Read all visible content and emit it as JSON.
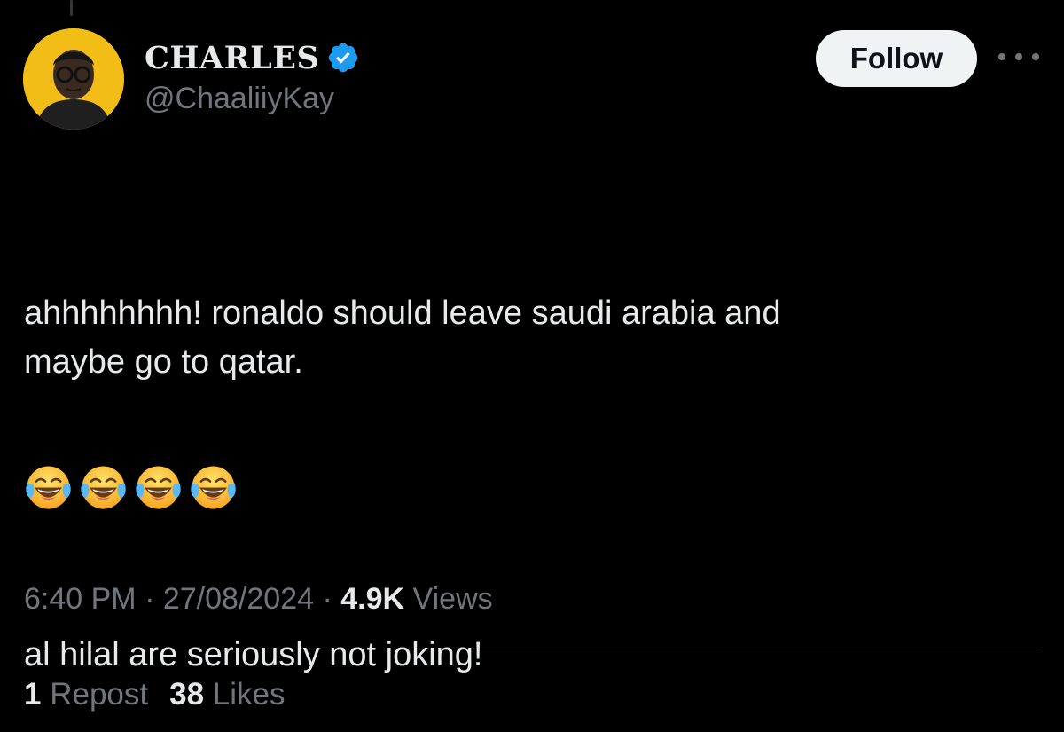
{
  "author": {
    "display_name": "CHARLES",
    "handle": "@ChaaliiyKay",
    "verified_icon": "verified-badge-icon",
    "avatar_bg": "#f2bd17"
  },
  "actions": {
    "follow_label": "Follow",
    "more_icon": "more-horizontal-icon"
  },
  "tweet": {
    "paragraphs": [
      "ahhhhhhhh! ronaldo should leave saudi arabia and\nmaybe go to qatar.",
      "al hilal are seriously not joking!"
    ],
    "emoji_name": "face-with-tears-of-joy-icon",
    "emoji_count": 4
  },
  "meta": {
    "time": "6:40 PM",
    "separator": "·",
    "date": "27/08/2024",
    "views_count": "4.9K",
    "views_label": "Views"
  },
  "stats": {
    "reposts_count": "1",
    "reposts_label": "Repost",
    "likes_count": "38",
    "likes_label": "Likes"
  },
  "colors": {
    "background": "#000000",
    "primary_text": "#e7e9ea",
    "secondary_text": "#71767b",
    "verified_blue": "#1d9bf0",
    "divider": "#2f3336"
  }
}
